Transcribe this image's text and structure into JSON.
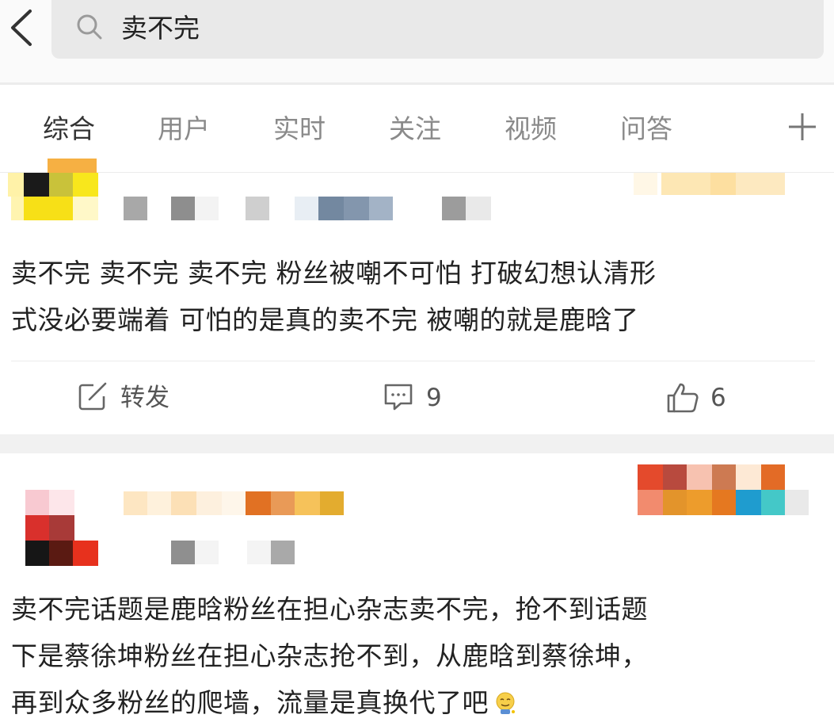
{
  "search": {
    "query": "卖不完",
    "icons": {
      "back": "chevron-left-icon",
      "search": "search-icon"
    }
  },
  "tabs": {
    "items": [
      {
        "label": "综合",
        "active": true
      },
      {
        "label": "用户"
      },
      {
        "label": "实时"
      },
      {
        "label": "关注"
      },
      {
        "label": "视频"
      },
      {
        "label": "问答"
      }
    ],
    "more_icon": "plus-icon"
  },
  "posts": [
    {
      "text_lines": [
        "卖不完 卖不完 卖不完 粉丝被嘲不可怕 打破幻想认清形",
        "式没必要端着 可怕的是真的卖不完 被嘲的就是鹿晗了"
      ],
      "actions": {
        "repost_label": "转发",
        "comment_count": "9",
        "like_count": "6"
      }
    },
    {
      "text_lines": [
        "卖不完话题是鹿晗粉丝在担心杂志卖不完，抢不到话题",
        "下是蔡徐坤粉丝在担心杂志抢不到，从鹿晗到蔡徐坤，",
        "再到众多粉丝的爬墙，流量是真换代了吧"
      ],
      "end_emoji": "awkward-smile-emoji"
    }
  ],
  "colors": {
    "search_bg": "#e9e9e9",
    "separator": "#f1f1f1",
    "tab_inactive": "#8a8a8a",
    "tab_active": "#333333"
  }
}
